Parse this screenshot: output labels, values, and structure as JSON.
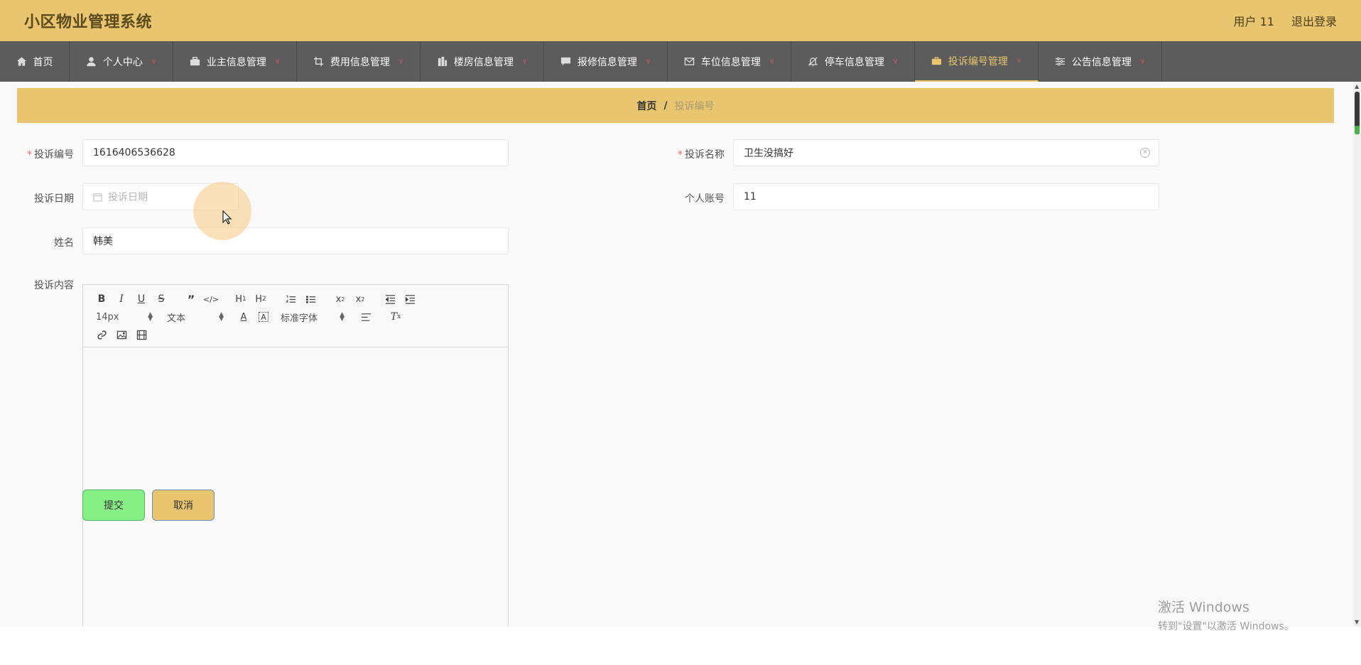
{
  "header": {
    "title": "小区物业管理系统",
    "user_label": "用户 11",
    "logout_label": "退出登录"
  },
  "nav": {
    "items": [
      {
        "label": "首页",
        "icon": "home-icon"
      },
      {
        "label": "个人中心",
        "icon": "user-icon"
      },
      {
        "label": "业主信息管理",
        "icon": "briefcase-icon"
      },
      {
        "label": "费用信息管理",
        "icon": "crop-icon"
      },
      {
        "label": "楼房信息管理",
        "icon": "building-icon"
      },
      {
        "label": "报修信息管理",
        "icon": "chat-icon"
      },
      {
        "label": "车位信息管理",
        "icon": "mail-icon"
      },
      {
        "label": "停车信息管理",
        "icon": "bell-off-icon"
      },
      {
        "label": "投诉编号管理",
        "icon": "toolbox-icon"
      },
      {
        "label": "公告信息管理",
        "icon": "sliders-icon"
      }
    ],
    "active_index": 8
  },
  "breadcrumb": {
    "home": "首页",
    "separator": "/",
    "current": "投诉编号"
  },
  "form": {
    "complaint_no_label": "投诉编号",
    "complaint_no_value": "1616406536628",
    "complaint_name_label": "投诉名称",
    "complaint_name_value": "卫生没搞好",
    "complaint_date_label": "投诉日期",
    "complaint_date_placeholder": "投诉日期",
    "account_label": "个人账号",
    "account_value": "11",
    "name_label": "姓名",
    "name_value": "韩美",
    "content_label": "投诉内容"
  },
  "editor": {
    "font_size": "14px",
    "header_select": "文本",
    "font_family": "标准字体"
  },
  "buttons": {
    "submit": "提交",
    "cancel": "取消"
  },
  "watermark": {
    "line1": "激活 Windows",
    "line2": "转到\"设置\"以激活 Windows。"
  },
  "colors": {
    "header_bg": "#e8c56e",
    "nav_bg": "#5c5c5c",
    "nav_active": "#e8c56e",
    "submit_bg": "#86ef86",
    "cancel_bg": "#e8c56e",
    "required": "#f56c6c"
  }
}
